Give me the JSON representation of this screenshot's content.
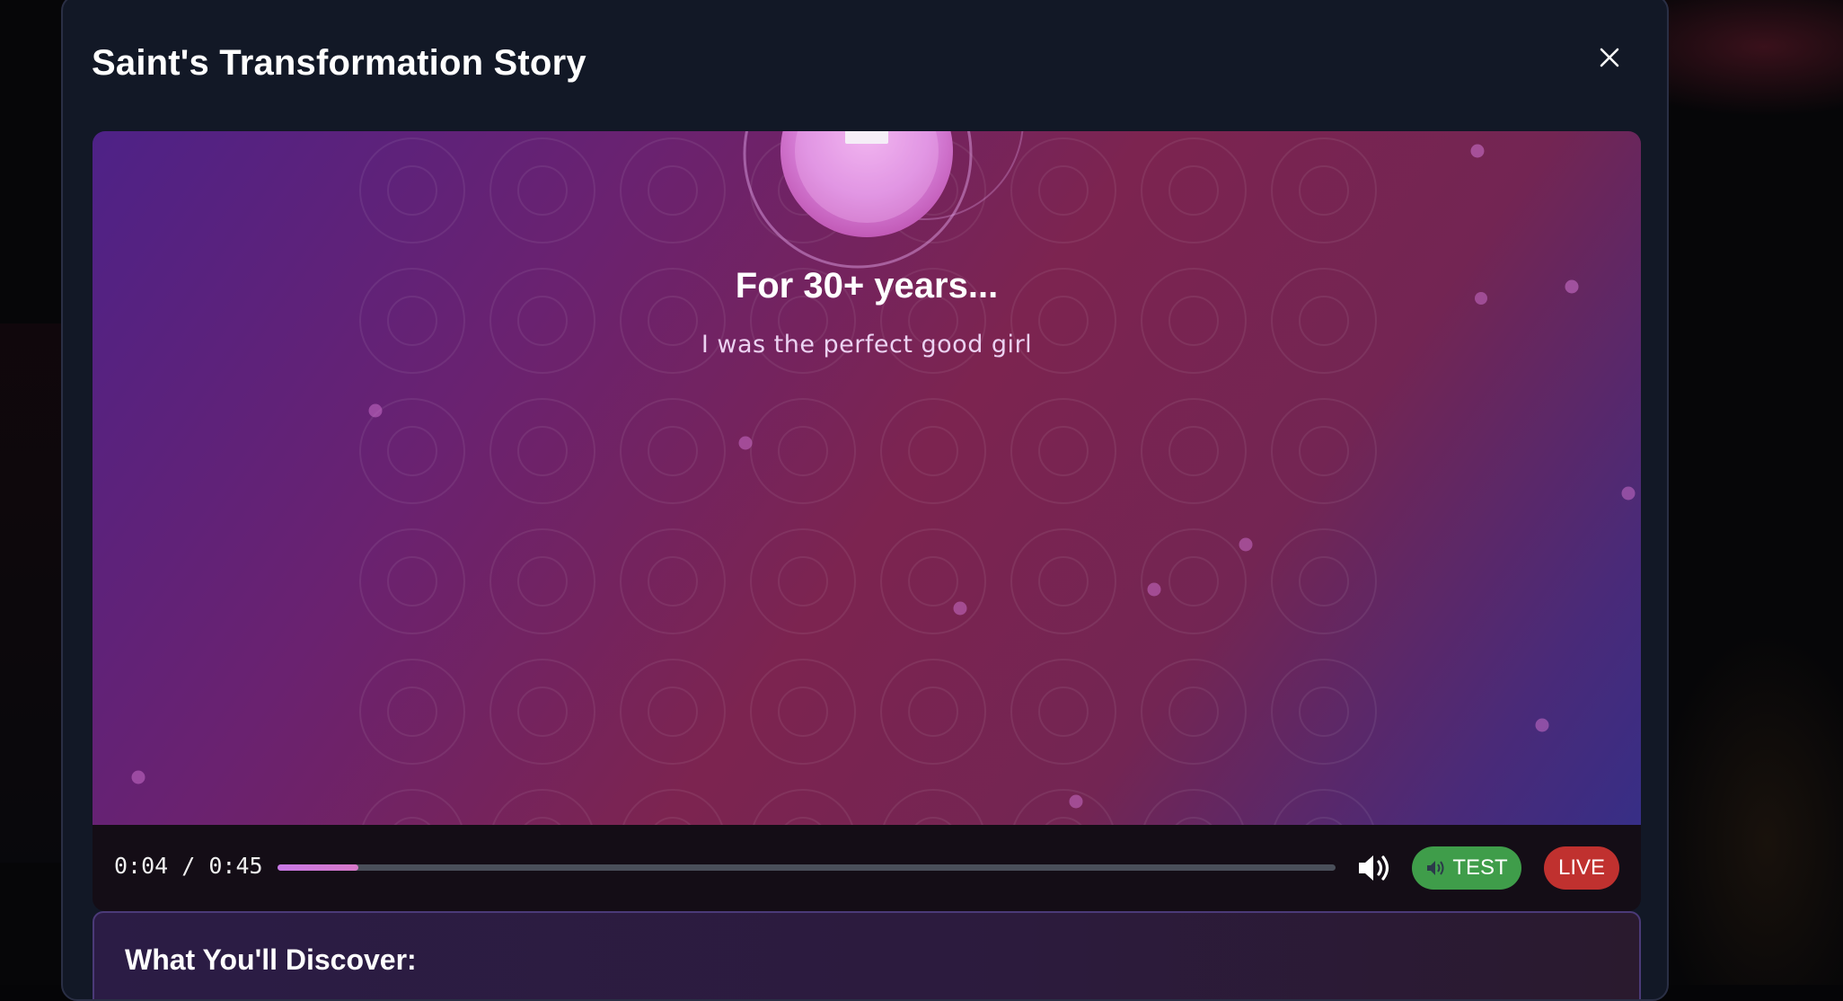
{
  "modal": {
    "title": "Saint's Transformation Story",
    "close_icon": "close-icon"
  },
  "video": {
    "headline": "For 30+ years...",
    "subline": "I was the perfect good girl",
    "current_time": "0:04",
    "duration": "0:45",
    "time_display": "0:04 / 0:45",
    "progress_fraction": 0.076,
    "volume_icon": "volume-up-icon",
    "test_button": {
      "icon": "speaker-icon",
      "label": "TEST",
      "color": "#3f9d4a"
    },
    "live_button": {
      "label": "LIVE",
      "color": "#c0312f"
    }
  },
  "discover": {
    "title": "What You'll Discover:"
  },
  "colors": {
    "modal_bg": "#121826",
    "accent_purple": "#c978e6",
    "gradient_start": "#4e2287",
    "gradient_mid": "#7c2450"
  }
}
